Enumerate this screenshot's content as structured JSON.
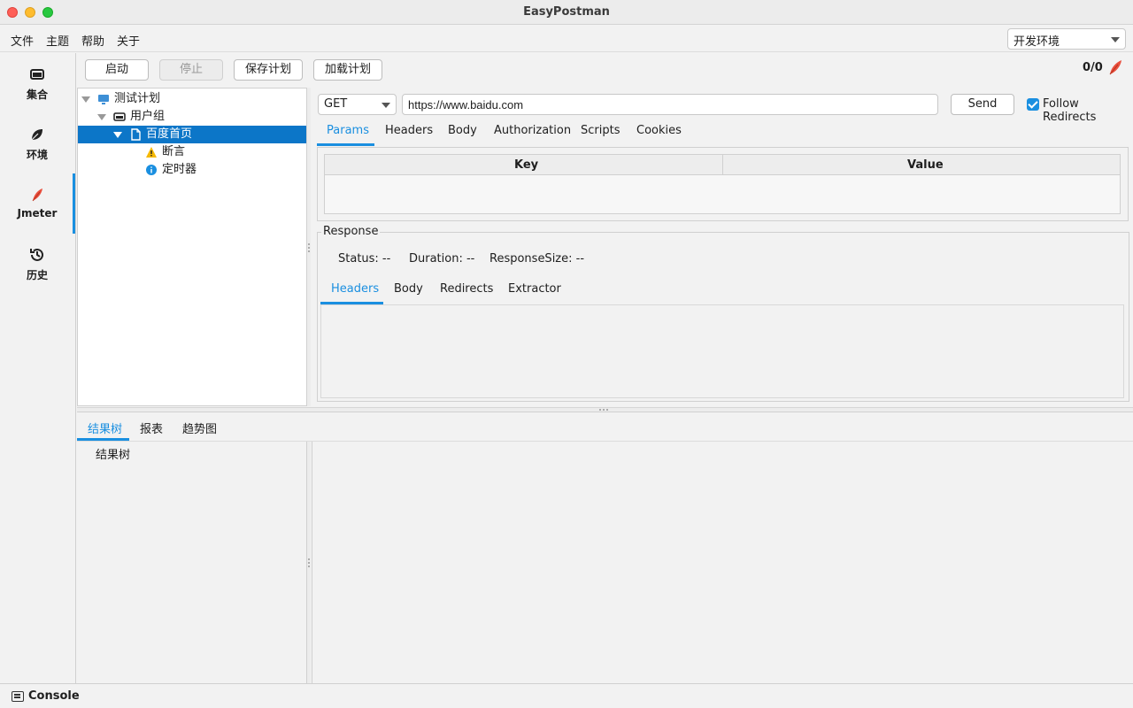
{
  "window": {
    "title": "EasyPostman"
  },
  "menubar": {
    "items": [
      "文件",
      "主题",
      "帮助",
      "关于"
    ],
    "environment": "开发环境"
  },
  "sidebar": {
    "items": [
      {
        "label": "集合",
        "icon": "collection-icon"
      },
      {
        "label": "环境",
        "icon": "leaf-icon"
      },
      {
        "label": "Jmeter",
        "icon": "feather-icon"
      },
      {
        "label": "历史",
        "icon": "history-icon"
      }
    ],
    "active": "Jmeter"
  },
  "toolbar": {
    "start": "启动",
    "stop": "停止",
    "save_plan": "保存计划",
    "load_plan": "加载计划",
    "counter": "0/0"
  },
  "tree": {
    "nodes": [
      {
        "label": "测试计划",
        "icon": "monitor-icon"
      },
      {
        "label": "用户组",
        "icon": "group-icon"
      },
      {
        "label": "百度首页",
        "icon": "file-icon"
      },
      {
        "label": "断言",
        "icon": "warning-icon"
      },
      {
        "label": "定时器",
        "icon": "info-icon"
      }
    ],
    "selected": "百度首页"
  },
  "request": {
    "method": "GET",
    "url": "https://www.baidu.com",
    "send": "Send",
    "follow_redirects": "Follow Redirects",
    "follow_redirects_checked": true,
    "tabs": [
      "Params",
      "Headers",
      "Body",
      "Authorization",
      "Scripts",
      "Cookies"
    ],
    "active_tab": "Params",
    "params_columns": [
      "Key",
      "Value"
    ]
  },
  "response": {
    "legend": "Response",
    "status": "Status: --",
    "duration": "Duration: --",
    "size": "ResponseSize: --",
    "tabs": [
      "Headers",
      "Body",
      "Redirects",
      "Extractor"
    ],
    "active_tab": "Headers"
  },
  "results": {
    "tabs": [
      "结果树",
      "报表",
      "趋势图"
    ],
    "active_tab": "结果树",
    "tree_root": "结果树"
  },
  "statusbar": {
    "console": "Console"
  },
  "colors": {
    "accent": "#1a8fe0",
    "selection": "#0c76c8"
  }
}
